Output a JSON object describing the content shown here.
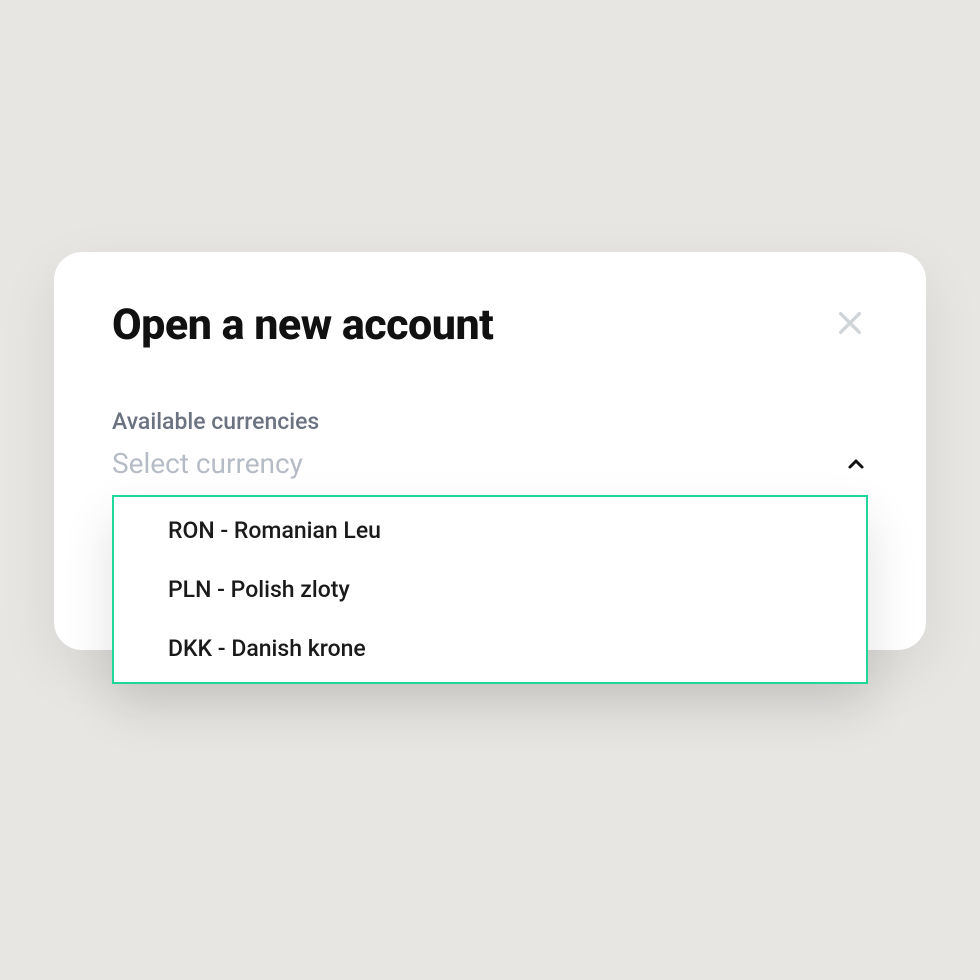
{
  "modal": {
    "title": "Open a new account",
    "close_icon": "close"
  },
  "currency_field": {
    "label": "Available currencies",
    "placeholder": "Select currency",
    "options": [
      "RON - Romanian Leu",
      "PLN - Polish zloty",
      "DKK - Danish krone"
    ]
  }
}
